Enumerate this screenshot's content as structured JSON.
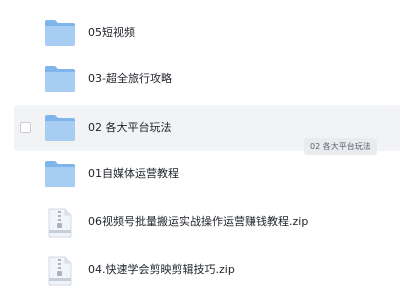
{
  "files": [
    {
      "name": "05短视频",
      "type": "folder"
    },
    {
      "name": "03-超全旅行攻略",
      "type": "folder"
    },
    {
      "name": "02 各大平台玩法",
      "type": "folder"
    },
    {
      "name": "01自媒体运营教程",
      "type": "folder"
    },
    {
      "name": "06视频号批量搬运实战操作运营赚钱教程.zip",
      "type": "zip"
    },
    {
      "name": "04.快速学会剪映剪辑技巧.zip",
      "type": "zip"
    }
  ],
  "tooltip": "02 各大平台玩法",
  "colors": {
    "folder_back": "#7fb5ea",
    "folder_front": "#a7cdf3",
    "zip_body": "#f1f4f8",
    "zip_zipper": "#aab3bf",
    "hover_row": "#f2f3f5"
  }
}
